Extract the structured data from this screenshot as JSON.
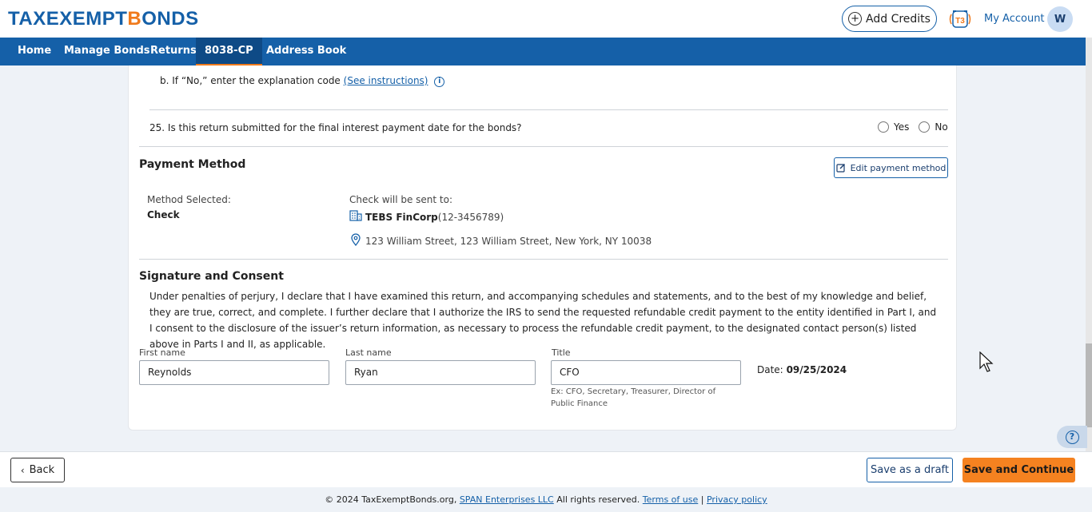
{
  "brand": {
    "part1": "TAXEXEMPT",
    "part2": "B",
    "part3": "ONDS",
    "accent_orange": "#f07a1c",
    "accent_blue": "#1560a8"
  },
  "header": {
    "add_credits": "Add Credits",
    "my_account": "My Account",
    "avatar_initial": "W",
    "badge_text": "T3"
  },
  "nav": {
    "items": [
      "Home",
      "Manage Bonds",
      "Returns",
      "8038-CP",
      "Address Book"
    ],
    "active": "8038-CP"
  },
  "question_b": {
    "text": "b. If “No,” enter the explanation code",
    "link": "(See instructions)"
  },
  "question_25": {
    "text": "25. Is this return submitted for the final interest payment date for the bonds?",
    "yes": "Yes",
    "no": "No"
  },
  "payment": {
    "title": "Payment Method",
    "edit_label": "Edit payment method",
    "method_label": "Method Selected:",
    "method_value": "Check",
    "sent_to_label": "Check will be sent to:",
    "company": "TEBS FinCorp",
    "ein": "(12-3456789)",
    "address": "123 William Street, 123 William Street, New York, NY 10038"
  },
  "signature": {
    "title": "Signature and Consent",
    "consent_text": "Under penalties of perjury, I declare that I have examined this return, and accompanying schedules and statements, and to the best of my knowledge and belief, they are true, correct, and complete. I further declare that I authorize the IRS to send the requested refundable credit payment to the entity identified in Part I, and I consent to the disclosure of the issuer’s return information, as necessary to process the refundable credit payment, to the designated contact person(s) listed above in Parts I and II, as applicable.",
    "first_name_label": "First name",
    "first_name_value": "Reynolds",
    "last_name_label": "Last name",
    "last_name_value": "Ryan",
    "title_label": "Title",
    "title_value": "CFO",
    "title_hint": "Ex: CFO, Secretary, Treasurer, Director of Public Finance",
    "date_label": "Date:",
    "date_value": "09/25/2024"
  },
  "actions": {
    "back": "Back",
    "save_draft": "Save as a draft",
    "save_continue": "Save and Continue"
  },
  "footer": {
    "copyright": "© 2024 TaxExemptBonds.org,",
    "company_link": "SPAN Enterprises LLC",
    "rights": "All rights reserved.",
    "terms": "Terms of use",
    "separator": "|",
    "privacy": "Privacy policy"
  }
}
